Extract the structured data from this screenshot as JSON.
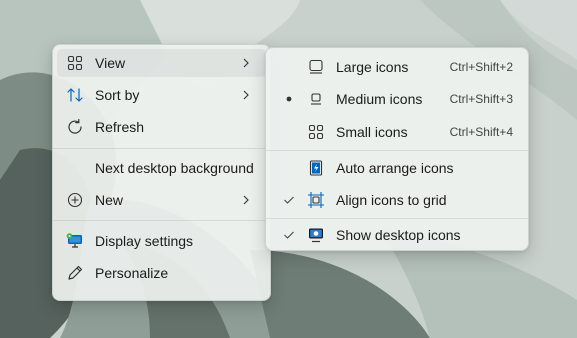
{
  "context_menu": {
    "items": [
      {
        "label": "View",
        "icon": "view-grid-icon",
        "has_submenu": true
      },
      {
        "label": "Sort by",
        "icon": "sort-icon",
        "has_submenu": true
      },
      {
        "label": "Refresh",
        "icon": "refresh-icon",
        "has_submenu": false
      },
      {
        "label": "Next desktop background",
        "icon": "",
        "has_submenu": false
      },
      {
        "label": "New",
        "icon": "add-icon",
        "has_submenu": true
      },
      {
        "label": "Display settings",
        "icon": "display-settings-icon",
        "has_submenu": false
      },
      {
        "label": "Personalize",
        "icon": "pen-icon",
        "has_submenu": false
      }
    ]
  },
  "view_submenu": {
    "items": [
      {
        "label": "Large icons",
        "shortcut": "Ctrl+Shift+2",
        "icon": "large-icons-icon",
        "state": "none"
      },
      {
        "label": "Medium icons",
        "shortcut": "Ctrl+Shift+3",
        "icon": "medium-icons-icon",
        "state": "bullet"
      },
      {
        "label": "Small icons",
        "shortcut": "Ctrl+Shift+4",
        "icon": "small-icons-icon",
        "state": "none"
      },
      {
        "label": "Auto arrange icons",
        "icon": "auto-arrange-icon",
        "state": "none"
      },
      {
        "label": "Align icons to grid",
        "icon": "align-grid-icon",
        "state": "check"
      },
      {
        "label": "Show desktop icons",
        "icon": "show-desktop-icon",
        "state": "check"
      }
    ]
  },
  "colors": {
    "menu_bg": "#eef2f0",
    "accent_blue": "#0067c0",
    "text": "#1b1b1b"
  }
}
